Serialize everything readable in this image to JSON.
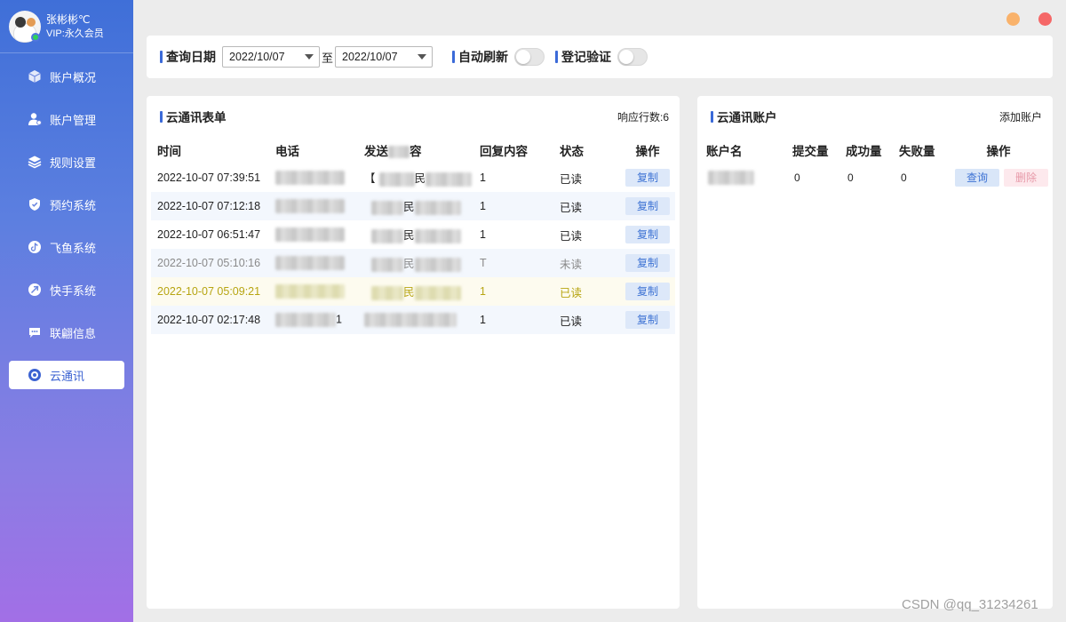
{
  "profile": {
    "name": "张彬彬℃",
    "vip": "VIP:永久会员"
  },
  "sidebar": {
    "items": [
      {
        "label": "账户概况",
        "icon": "cube-icon"
      },
      {
        "label": "账户管理",
        "icon": "user-icon"
      },
      {
        "label": "规则设置",
        "icon": "layers-icon"
      },
      {
        "label": "预约系统",
        "icon": "shield-icon"
      },
      {
        "label": "飞鱼系统",
        "icon": "tiktok-icon"
      },
      {
        "label": "快手系统",
        "icon": "kuaishou-icon"
      },
      {
        "label": "联翩信息",
        "icon": "chat-icon"
      },
      {
        "label": "云通讯",
        "icon": "target-icon",
        "active": true
      }
    ]
  },
  "filter": {
    "date_label": "查询日期",
    "start_date": "2022/10/07",
    "separator": "至",
    "end_date": "2022/10/07",
    "auto_refresh_label": "自动刷新",
    "auto_refresh_on": false,
    "verify_label": "登记验证",
    "verify_on": false
  },
  "messages_panel": {
    "title": "云通讯表单",
    "extra": "响应行数:6",
    "columns": [
      "时间",
      "电话",
      "发送",
      "容",
      "回复内容",
      "状态",
      "操作"
    ],
    "rows": [
      {
        "time": "2022-10-07 07:39:51",
        "content_prefix": "【",
        "content_suffix": "民",
        "reply": "1",
        "status": "已读",
        "action": "复制"
      },
      {
        "time": "2022-10-07 07:12:18",
        "content_prefix": "",
        "content_suffix": "民",
        "reply": "1",
        "status": "已读",
        "action": "复制"
      },
      {
        "time": "2022-10-07 06:51:47",
        "content_prefix": "",
        "content_suffix": "民",
        "reply": "1",
        "status": "已读",
        "action": "复制"
      },
      {
        "time": "2022-10-07 05:10:16",
        "content_prefix": "",
        "content_suffix": "民",
        "reply": "T",
        "status": "未读",
        "action": "复制"
      },
      {
        "time": "2022-10-07 05:09:21",
        "content_prefix": "",
        "content_suffix": "民",
        "reply": "1",
        "status": "已读",
        "action": "复制"
      },
      {
        "time": "2022-10-07 02:17:48",
        "phone_suffix": "1",
        "content_prefix": "",
        "content_suffix": "",
        "reply": "1",
        "status": "已读",
        "action": "复制"
      }
    ]
  },
  "accounts_panel": {
    "title": "云通讯账户",
    "extra": "添加账户",
    "columns": [
      "账户名",
      "提交量",
      "成功量",
      "失败量",
      "操作"
    ],
    "rows": [
      {
        "submitted": "0",
        "success": "0",
        "failed": "0",
        "query": "查询",
        "delete": "删除"
      }
    ]
  },
  "watermark": "CSDN @qq_31234261",
  "colors": {
    "accent": "#3b6ad8",
    "unread": "#8a8a8a",
    "highlight": "#b7a512",
    "minimize": "#f9b26b",
    "close": "#f56767"
  }
}
